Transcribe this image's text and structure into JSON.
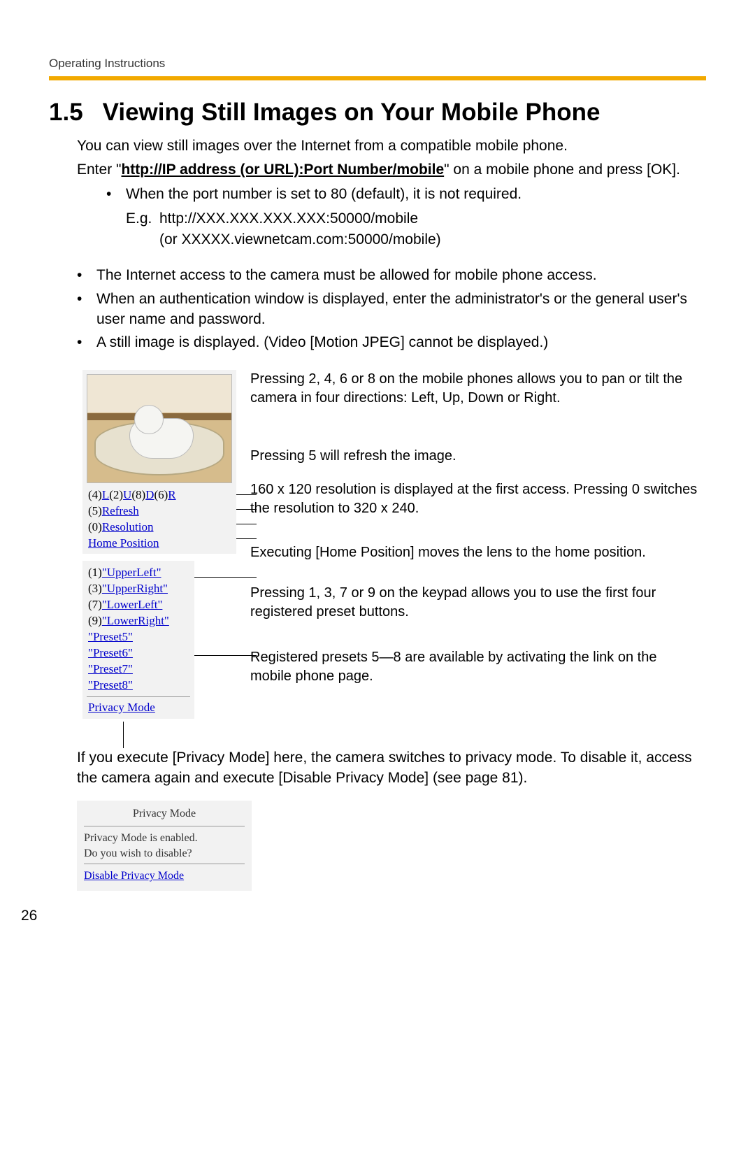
{
  "header": {
    "running": "Operating Instructions"
  },
  "section": {
    "number": "1.5",
    "title": "Viewing Still Images on Your Mobile Phone"
  },
  "intro": {
    "p1": "You can view still images over the Internet from a compatible mobile phone.",
    "p2a": "Enter \"",
    "p2_link": "http://IP address (or URL):Port Number/mobile",
    "p2b": "\" on a mobile phone and press [OK].",
    "bullet_port": "When the port number is set to 80 (default), it is not required.",
    "eg_label": "E.g.",
    "eg1": "http://XXX.XXX.XXX.XXX:50000/mobile",
    "eg2": "(or XXXXX.viewnetcam.com:50000/mobile)"
  },
  "bullets": [
    "The Internet access to the camera must be allowed for mobile phone access.",
    "When an authentication window is displayed, enter the administrator's or the general user's user name and password.",
    "A still image is displayed. (Video [Motion JPEG] cannot be displayed.)"
  ],
  "phone": {
    "nav_raw_prefix": "(4)",
    "nav_L": "L",
    "nav_mid1": "(2)",
    "nav_U": "U",
    "nav_mid2": "(8)",
    "nav_D": "D",
    "nav_mid3": "(6)",
    "nav_R": "R",
    "refresh_prefix": "(5)",
    "refresh": "Refresh",
    "res_prefix": "(0)",
    "res": "Resolution",
    "home": "Home Position",
    "presets_numbered": [
      {
        "n": "(1)",
        "t": "\"UpperLeft\""
      },
      {
        "n": "(3)",
        "t": "\"UpperRight\""
      },
      {
        "n": "(7)",
        "t": "\"LowerLeft\""
      },
      {
        "n": "(9)",
        "t": "\"LowerRight\""
      }
    ],
    "presets_extra": [
      "\"Preset5\"",
      "\"Preset6\"",
      "\"Preset7\"",
      "\"Preset8\""
    ],
    "privacy": "Privacy Mode"
  },
  "callouts": {
    "c1": "Pressing 2, 4, 6 or 8 on the mobile phones allows you to pan or tilt the camera in four directions: Left, Up, Down or Right.",
    "c2": "Pressing 5 will refresh the image.",
    "c3": "160 x 120 resolution is displayed at the first access. Pressing 0 switches the resolution to 320 x 240.",
    "c4": "Executing [Home Position] moves the lens to the home position.",
    "c5": "Pressing 1, 3, 7 or 9 on the keypad allows you to use the first four registered preset buttons.",
    "c6": "Registered presets 5—8 are available by activating the link on the mobile phone page."
  },
  "privacy_para": "If you execute [Privacy Mode] here, the camera switches to privacy mode. To disable it, access the camera again and execute [Disable Privacy Mode] (see page 81).",
  "privacy_box": {
    "title": "Privacy Mode",
    "line1": "Privacy Mode is enabled.",
    "line2": "Do you wish to disable?",
    "link": "Disable Privacy Mode"
  },
  "page_number": "26"
}
